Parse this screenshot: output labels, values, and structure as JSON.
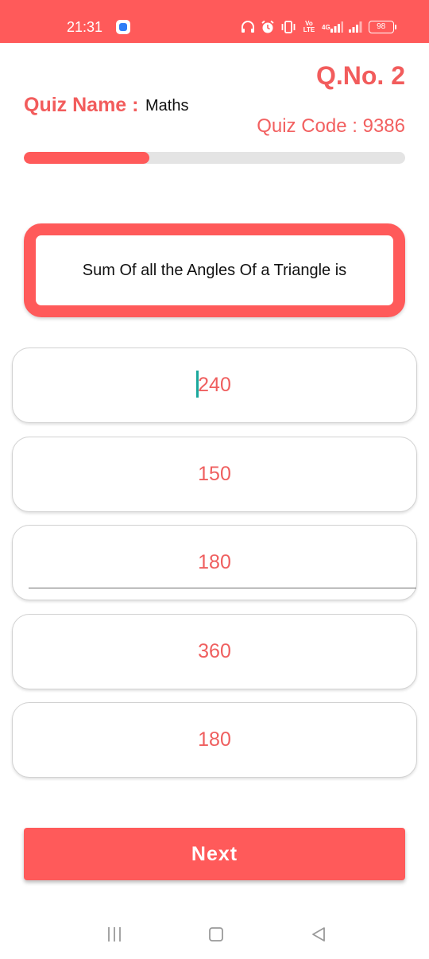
{
  "status_bar": {
    "time": "21:31",
    "notification_icon": "app-notification-icon",
    "volte_label": "Vo LTE",
    "network_label": "4G",
    "battery_level": "98",
    "icons": [
      "headphones-icon",
      "alarm-icon",
      "vibrate-icon",
      "volte-icon",
      "signal-icon",
      "signal-icon",
      "battery-icon"
    ]
  },
  "header": {
    "question_number": "Q.No. 2",
    "quiz_name_label": "Quiz Name :",
    "quiz_name": "Maths",
    "quiz_code_label": "Quiz Code : ",
    "quiz_code": "9386"
  },
  "progress": {
    "fraction": 0.33,
    "color": "#ff5a5a",
    "track_color": "#e4e4e4"
  },
  "question": {
    "text": "Sum Of all the Angles Of a Triangle is"
  },
  "options": [
    {
      "label": "240"
    },
    {
      "label": "150"
    },
    {
      "label": "180"
    },
    {
      "label": "360"
    },
    {
      "label": "180"
    }
  ],
  "next_button": {
    "label": "Next"
  },
  "nav_bar": {
    "icons": [
      "recents-icon",
      "home-icon",
      "back-icon"
    ]
  },
  "colors": {
    "accent": "#ff5a5a",
    "accent_text": "#f25c5c",
    "cursor": "#1aa79c"
  }
}
